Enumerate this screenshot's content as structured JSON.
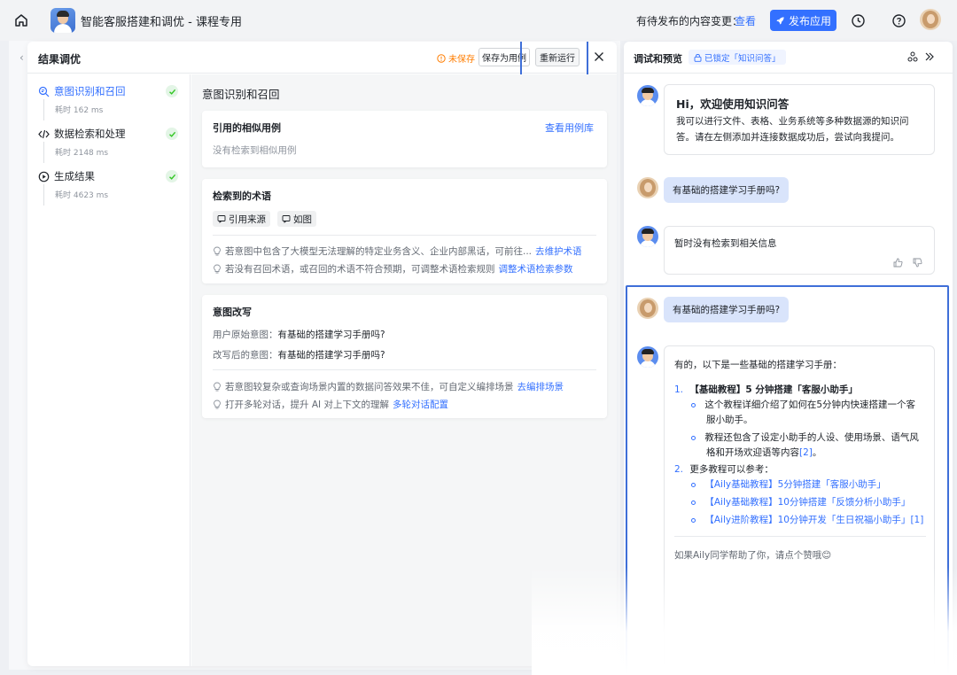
{
  "topbar": {
    "app_title": "智能客服搭建和调优 - 课程专用",
    "pending_text": "有待发布的内容变更：",
    "pending_link": "查看",
    "publish_label": "发布应用"
  },
  "result_panel": {
    "title": "结果调优",
    "unsaved": "未保存",
    "save_case": "保存为用例",
    "rerun": "重新运行",
    "steps": [
      {
        "label": "意图识别和召回",
        "time": "耗时 162 ms"
      },
      {
        "label": "数据检索和处理",
        "time": "耗时 2148 ms"
      },
      {
        "label": "生成结果",
        "time": "耗时 4623 ms"
      }
    ],
    "detail_title": "意图识别和召回",
    "similar_cases": {
      "title": "引用的相似用例",
      "link": "查看用例库",
      "empty": "没有检索到相似用例"
    },
    "terms": {
      "title": "检索到的术语",
      "tag1": "引用来源",
      "tag2": "如图",
      "tip1_text": "若意图中包含了大模型无法理解的特定业务含义、企业内部黑话，可前往...",
      "tip1_link": "去维护术语",
      "tip2_text": "若没有召回术语，或召回的术语不符合预期，可调整术语检索规则",
      "tip2_link": "调整术语检索参数"
    },
    "rewrite": {
      "title": "意图改写",
      "orig_key": "用户原始意图：",
      "orig_val": "有基础的搭建学习手册吗?",
      "new_key": "改写后的意图：",
      "new_val": "有基础的搭建学习手册吗?",
      "tip1_text": "若意图较复杂或查询场景内置的数据问答效果不佳，可自定义编排场景",
      "tip1_link": "去编排场景",
      "tip2_text": "打开多轮对话，提升 AI 对上下文的理解",
      "tip2_link": "多轮对话配置"
    }
  },
  "debug_panel": {
    "title": "调试和预览",
    "lock": "已锁定「知识问答」",
    "welcome_title": "Hi，欢迎使用知识问答",
    "welcome_text": "我可以进行文件、表格、业务系统等多种数据源的知识问答。请在左侧添加并连接数据成功后，尝试向我提问。",
    "user_q1": "有基础的搭建学习手册吗?",
    "bot_a1": "暂时没有检索到相关信息",
    "user_q2": "有基础的搭建学习手册吗?",
    "answer": {
      "intro": "有的，以下是一些基础的搭建学习手册：",
      "item1_num": "1.",
      "item1_title": "【基础教程】5 分钟搭建「客服小助手」",
      "item1_sub1_line1": "这个教程详细介绍了如何在5分钟内快速搭建一个客",
      "item1_sub1_line2": "服小助手。",
      "item1_sub2_line1": "教程还包含了设定小助手的人设、使用场景、语气风",
      "item1_sub2_line2": "格和开场欢迎语等内容",
      "item1_sub2_ref": "[2]",
      "item1_sub2_end": "。",
      "item2_num": "2.",
      "item2_title": "更多教程可以参考：",
      "links": [
        "【Aily基础教程】5分钟搭建「客服小助手」",
        "【Aily基础教程】10分钟搭建「反馈分析小助手」",
        "【Aily进阶教程】10分钟开发「生日祝福小助手」"
      ],
      "link3_ref": "[1]",
      "outro": "如果Aily同学帮助了你，请点个赞哦😊"
    }
  },
  "colors": {
    "accent": "#3370ff",
    "warning": "#ff7d00",
    "success": "#34c724",
    "highlight": "#3f6fd8"
  },
  "icons": [
    "home-icon",
    "rocket-icon",
    "history-icon",
    "help-icon",
    "close-icon",
    "search-intent-icon",
    "code-icon",
    "play-circle-icon",
    "check-icon",
    "bulb-icon",
    "quote-icon",
    "lock-icon",
    "share-icon",
    "double-chevron-right-icon",
    "thumb-up-icon",
    "thumb-down-icon",
    "chevron-left-icon",
    "warning-circle-icon"
  ]
}
